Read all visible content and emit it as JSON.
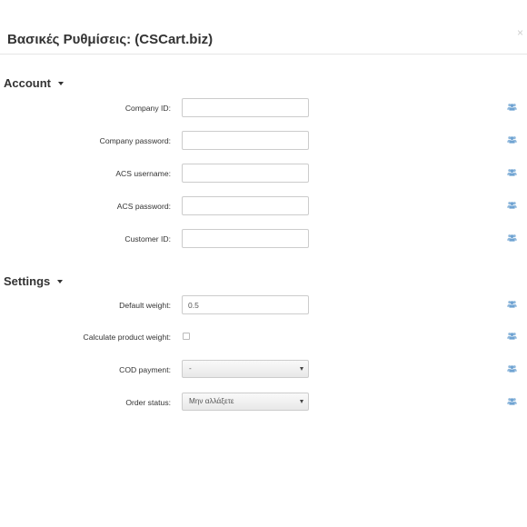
{
  "modal": {
    "title": "Βασικές Ρυθμίσεις: (CSCart.biz)",
    "close_glyph": "×"
  },
  "sections": {
    "account": {
      "title": "Account",
      "fields": {
        "company_id": {
          "label": "Company ID:",
          "value": ""
        },
        "company_password": {
          "label": "Company password:",
          "value": ""
        },
        "acs_username": {
          "label": "ACS username:",
          "value": ""
        },
        "acs_password": {
          "label": "ACS password:",
          "value": ""
        },
        "customer_id": {
          "label": "Customer ID:",
          "value": ""
        }
      }
    },
    "settings": {
      "title": "Settings",
      "fields": {
        "default_weight": {
          "label": "Default weight:",
          "value": "0.5"
        },
        "calculate_product_weight": {
          "label": "Calculate product weight:",
          "checked": false
        },
        "cod_payment": {
          "label": "COD payment:",
          "selected": "-"
        },
        "order_status": {
          "label": "Order status:",
          "selected": "Μην αλλάξετε"
        }
      }
    }
  },
  "icons": {
    "row_icon": "users-group-icon",
    "section_toggle": "caret-down-icon",
    "close": "close-icon"
  },
  "colors": {
    "row_icon": "#8fb8dc",
    "title": "#333333",
    "input_border": "#cccccc",
    "header_divider": "#e5e5e5"
  }
}
